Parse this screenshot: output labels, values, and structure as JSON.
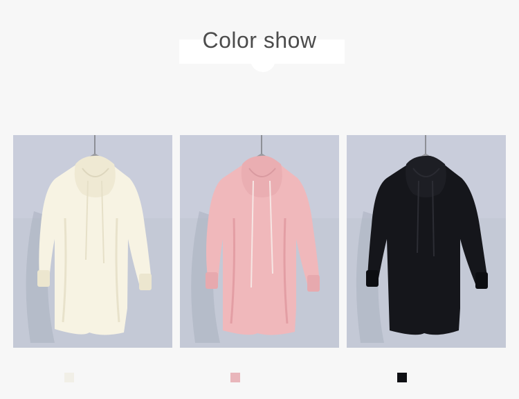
{
  "header": {
    "title": "Color show"
  },
  "colors": [
    {
      "name": "white",
      "swatch": "#f1efe7",
      "garment": "#f7f3e3",
      "shade": "#e8e2cb"
    },
    {
      "name": "pink",
      "swatch": "#e9b6bb",
      "garment": "#f0b8bb",
      "shade": "#e39ea4"
    },
    {
      "name": "black",
      "swatch": "#0f1014",
      "garment": "#15161b",
      "shade": "#08090c"
    }
  ],
  "backdrop": {
    "wall": "#c3c8d6"
  }
}
